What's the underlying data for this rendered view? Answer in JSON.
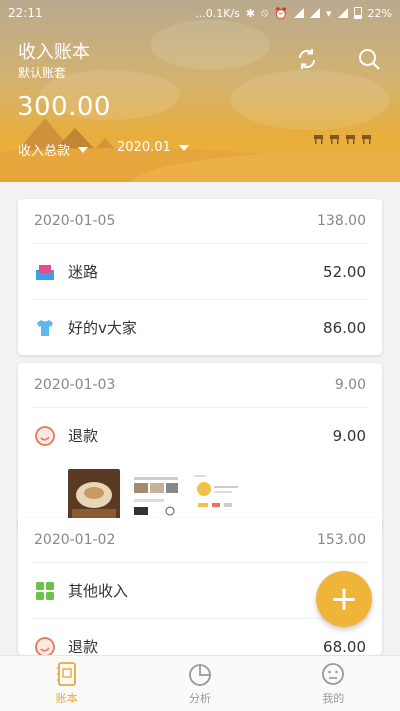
{
  "status": {
    "time": "22:11",
    "network": "...0.1K/s",
    "battery": "22%"
  },
  "header": {
    "title": "收入账本",
    "subtitle": "默认账套",
    "total": "300.00",
    "total_label": "收入总款",
    "month": "2020.01",
    "icons": [
      "refresh-icon",
      "search-icon"
    ]
  },
  "cards": [
    {
      "date": "2020-01-05",
      "sum": "138.00",
      "items": [
        {
          "icon": "wallet-icon",
          "label": "迷路",
          "amount": "52.00"
        },
        {
          "icon": "shirt-icon",
          "label": "好的v大家",
          "amount": "86.00"
        }
      ]
    },
    {
      "date": "2020-01-03",
      "sum": "9.00",
      "items": [
        {
          "icon": "refund-icon",
          "label": "退款",
          "amount": "9.00"
        }
      ],
      "attachments": 3
    },
    {
      "date": "2020-01-02",
      "sum": "153.00",
      "items": [
        {
          "icon": "grid-icon",
          "label": "其他收入",
          "amount": ""
        },
        {
          "icon": "refund-icon",
          "label": "退款",
          "amount": "68.00"
        }
      ]
    }
  ],
  "fab": {
    "label": "+"
  },
  "nav": {
    "items": [
      {
        "label": "账本",
        "icon": "ledger-icon",
        "active": true
      },
      {
        "label": "分析",
        "icon": "pie-chart-icon",
        "active": false
      },
      {
        "label": "我的",
        "icon": "profile-icon",
        "active": false
      }
    ]
  },
  "colors": {
    "accent": "#f1b43a",
    "nav_active": "#e9a93a",
    "refund": "#e8765c",
    "grid": "#6cc24a",
    "shirt": "#3aa0e8",
    "wallet": "#e84a8a"
  }
}
